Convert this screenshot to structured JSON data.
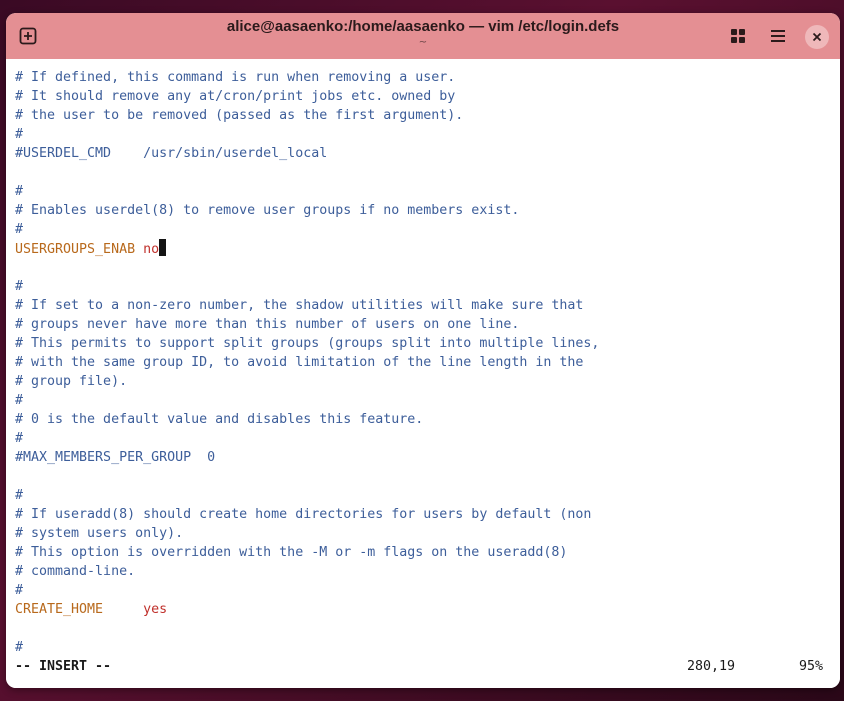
{
  "window": {
    "title": "alice@aasaenko:/home/aasaenko — vim /etc/login.defs",
    "subtitle": "~"
  },
  "header_buttons": {
    "new_tab_icon": "plus-square-icon",
    "grid_icon": "grid-icon",
    "menu_icon": "hamburger-menu-icon",
    "close_icon": "close-icon"
  },
  "colors": {
    "titlebar": "#e48f93",
    "comment": "#3d5e9a",
    "keyword": "#b8691c",
    "value": "#c0302b"
  },
  "editor": {
    "lines": [
      "# If defined, this command is run when removing a user.",
      "# It should remove any at/cron/print jobs etc. owned by",
      "# the user to be removed (passed as the first argument).",
      "#",
      "#USERDEL_CMD    /usr/sbin/userdel_local",
      "",
      "#",
      "# Enables userdel(8) to remove user groups if no members exist.",
      "#",
      "USERGROUPS_ENAB",
      "",
      "#",
      "# If set to a non-zero number, the shadow utilities will make sure that",
      "# groups never have more than this number of users on one line.",
      "# This permits to support split groups (groups split into multiple lines,",
      "# with the same group ID, to avoid limitation of the line length in the",
      "# group file).",
      "#",
      "# 0 is the default value and disables this feature.",
      "#",
      "#MAX_MEMBERS_PER_GROUP  0",
      "",
      "#",
      "# If useradd(8) should create home directories for users by default (non",
      "# system users only).",
      "# This option is overridden with the -M or -m flags on the useradd(8)",
      "# command-line.",
      "#",
      "CREATE_HOME",
      "",
      "#"
    ],
    "usergroups_value": "no",
    "create_home_value": "yes"
  },
  "statusline": {
    "mode": "-- INSERT --",
    "position": "280,19",
    "percent": "95%"
  }
}
